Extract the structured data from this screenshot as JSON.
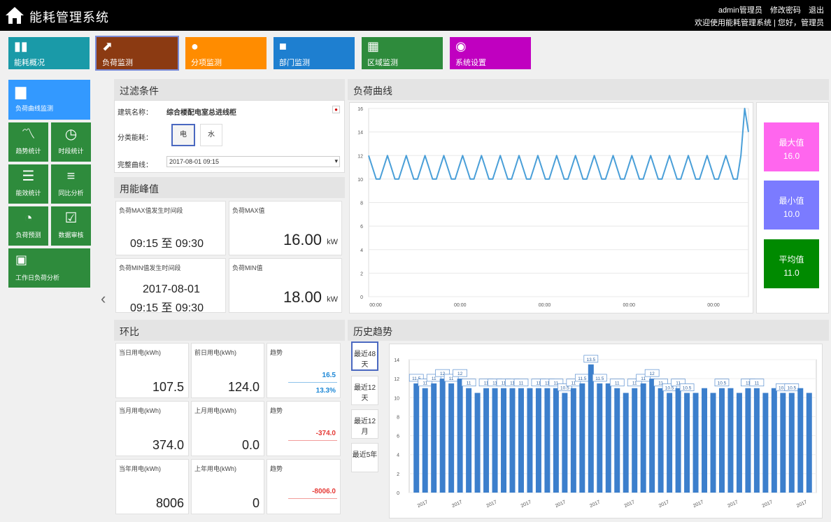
{
  "app": {
    "title": "能耗管理系统"
  },
  "header": {
    "links": [
      "admin管理员",
      "修改密码",
      "退出"
    ],
    "sub": "欢迎使用能耗管理系统 | 您好，管理员"
  },
  "nav": [
    {
      "label": "能耗概况",
      "icon": "bar-chart-icon",
      "color": "#1a9aa8"
    },
    {
      "label": "负荷监测",
      "icon": "trend-icon",
      "color": "#8b3a12"
    },
    {
      "label": "分项监测",
      "icon": "person-icon",
      "color": "#ff8c00"
    },
    {
      "label": "部门监测",
      "icon": "cube-icon",
      "color": "#1e7fd0"
    },
    {
      "label": "区域监测",
      "icon": "grid-icon",
      "color": "#2e8b3c"
    },
    {
      "label": "系统设置",
      "icon": "settings-icon",
      "color": "#c000c0"
    }
  ],
  "sidebar": {
    "main": {
      "label": "负荷曲线监测",
      "icon": "book-icon"
    },
    "items": [
      {
        "label": "趋势统计",
        "icon": "line-chart-icon"
      },
      {
        "label": "时段统计",
        "icon": "clock-icon"
      },
      {
        "label": "能效统计",
        "icon": "document-icon"
      },
      {
        "label": "同比分析",
        "icon": "database-icon"
      },
      {
        "label": "负荷预测",
        "icon": "satellite-icon"
      },
      {
        "label": "数据审核",
        "icon": "check-icon"
      }
    ],
    "bottom": {
      "label": "工作日负荷分析",
      "icon": "calendar-icon"
    }
  },
  "filter": {
    "title": "过滤条件",
    "building_label": "建筑名称：",
    "building_value": "综合楼配电室总进线柜",
    "type_label": "分类能耗：",
    "type_opt1": "电",
    "type_opt2": "水",
    "time_label": "完整曲线：",
    "time_value": "2017-08-01 09:15"
  },
  "peak": {
    "title": "用能峰值",
    "cards": [
      {
        "title": "负荷MAX值发生时间段",
        "date": "",
        "range": "09:15  至  09:30"
      },
      {
        "title": "负荷MAX值",
        "value": "16.00",
        "unit": "kW"
      },
      {
        "title": "负荷MIN值发生时间段",
        "date": "2017-08-01",
        "range": "09:15  至  09:30"
      },
      {
        "title": "负荷MIN值",
        "value": "18.00",
        "unit": "kW"
      }
    ]
  },
  "compare": {
    "title": "环比",
    "rows": [
      {
        "a_title": "当日用电(kWh)",
        "a_val": "107.5",
        "b_title": "前日用电(kWh)",
        "b_val": "124.0",
        "c_title": "趋势",
        "c_val1": "16.5",
        "c_val2": "13.3%",
        "c_color": "#1e88d6"
      },
      {
        "a_title": "当月用电(kWh)",
        "a_val": "374.0",
        "b_title": "上月用电(kWh)",
        "b_val": "0.0",
        "c_title": "趋势",
        "c_val1": "-374.0",
        "c_val2": "",
        "c_color": "#e53935"
      },
      {
        "a_title": "当年用电(kWh)",
        "a_val": "8006",
        "b_title": "上年用电(kWh)",
        "b_val": "0",
        "c_title": "趋势",
        "c_val1": "-8006.0",
        "c_val2": "",
        "c_color": "#e53935"
      }
    ]
  },
  "load": {
    "title": "负荷曲线",
    "kpis": [
      {
        "label": "最大值",
        "value": "16.0",
        "color": "#ff66ee"
      },
      {
        "label": "最小值",
        "value": "10.0",
        "color": "#7b7bff"
      },
      {
        "label": "平均值",
        "value": "11.0",
        "color": "#008a00"
      }
    ]
  },
  "history": {
    "title": "历史趋势",
    "buttons": [
      "最近48天",
      "最近12天",
      "最近12月",
      "最近5年"
    ]
  },
  "chart_data": [
    {
      "type": "line",
      "title": "",
      "ylim": [
        0,
        16
      ],
      "yticks": [
        0,
        2,
        4,
        6,
        8,
        10,
        12,
        14,
        16
      ],
      "xticks": [
        "00:00",
        "00:00",
        "00:00",
        "00:00",
        "00:00"
      ],
      "grid": true,
      "series": [
        {
          "values": [
            12,
            11,
            10,
            10,
            11,
            12,
            11,
            10,
            10,
            11,
            12,
            11,
            10,
            10,
            11,
            12,
            11,
            10,
            10,
            11,
            12,
            11,
            10,
            10,
            11,
            12,
            11,
            10,
            10,
            11,
            12,
            11,
            10,
            10,
            11,
            12,
            11,
            10,
            10,
            11,
            12,
            11,
            10,
            10,
            11,
            12,
            11,
            10,
            10,
            11,
            12,
            11,
            10,
            10,
            11,
            12,
            11,
            10,
            10,
            11,
            12,
            11,
            10,
            10,
            11,
            12,
            11,
            10,
            10,
            11,
            12,
            11,
            10,
            10,
            11,
            12,
            11,
            10,
            10,
            11,
            12,
            11,
            10,
            10,
            11,
            12,
            11,
            10,
            10,
            11,
            12,
            11,
            10,
            10,
            11,
            12,
            11,
            10,
            10,
            12,
            16,
            14
          ]
        }
      ]
    },
    {
      "type": "bar",
      "ylim": [
        0,
        14
      ],
      "yticks": [
        0,
        2,
        4,
        6,
        8,
        10,
        12,
        14
      ],
      "grid": true,
      "categories": [
        "2017",
        "2017",
        "2017",
        "2017",
        "2017",
        "2017",
        "2017",
        "2017",
        "2017",
        "2017",
        "2017",
        "2017",
        "2017",
        "2017",
        "2017",
        "2017",
        "2017",
        "2017",
        "2017",
        "2017",
        "2017",
        "2017",
        "2017",
        "2017",
        "2017",
        "2017",
        "2017",
        "2017",
        "2017",
        "2017",
        "2017",
        "2017",
        "2017",
        "2017",
        "2017",
        "2017",
        "2017",
        "2017",
        "2017",
        "2017",
        "2017",
        "2017",
        "2017",
        "2017",
        "2017",
        "2017"
      ],
      "xticks": [
        "2017",
        "2017",
        "2017",
        "2017",
        "2017",
        "2017",
        "2017",
        "2017",
        "2017",
        "2017",
        "2017",
        "2017"
      ],
      "values": [
        11.5,
        11,
        11.5,
        12,
        11.5,
        12,
        11,
        10.5,
        11,
        11,
        11,
        11,
        11,
        11,
        11,
        11,
        11,
        10.5,
        11,
        11.5,
        13.5,
        11.5,
        11.5,
        11,
        10.5,
        11,
        11.5,
        12,
        11,
        10.5,
        11,
        10.5,
        10.5,
        11,
        10.5,
        11,
        11,
        10.5,
        11,
        11,
        10.5,
        11,
        10.5,
        10.5,
        11,
        10.5
      ],
      "labels": [
        "11.5",
        "11",
        "11",
        "12",
        "11",
        "12",
        "11",
        "",
        "11",
        "11",
        "11",
        "11",
        "11",
        "",
        "11",
        "11",
        "11",
        "10.5",
        "11",
        "11.5",
        "13.5",
        "11.5",
        "",
        "11",
        "",
        "11",
        "11",
        "12",
        "11",
        "10.5",
        "11",
        "10.5",
        "",
        "",
        "",
        "10.5",
        "",
        "",
        "11",
        "11",
        "",
        "",
        "10.5",
        "10.5",
        "",
        ""
      ]
    }
  ]
}
